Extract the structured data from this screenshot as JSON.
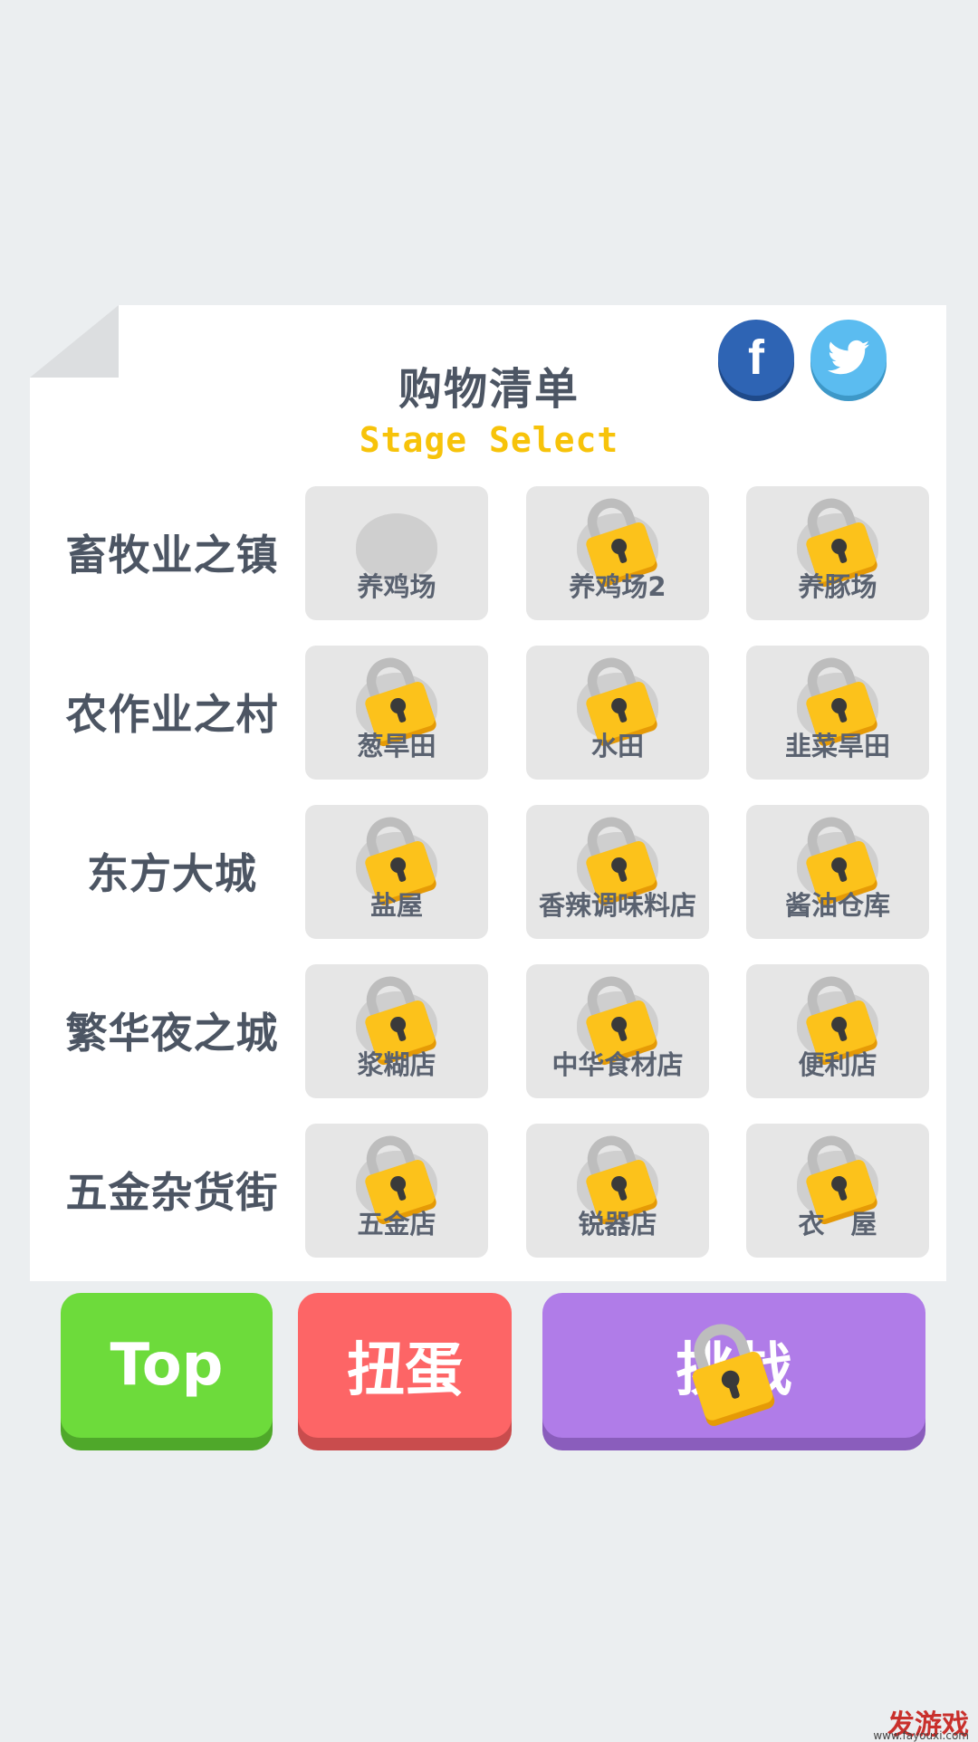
{
  "header": {
    "title": "购物清单",
    "subtitle": "Stage Select"
  },
  "social": {
    "facebook_icon": "facebook-icon",
    "twitter_icon": "twitter-icon"
  },
  "rows": [
    {
      "label": "畜牧业之镇",
      "stages": [
        {
          "name": "养鸡场",
          "locked": false
        },
        {
          "name": "养鸡场2",
          "locked": true
        },
        {
          "name": "养豚场",
          "locked": true
        }
      ]
    },
    {
      "label": "农作业之村",
      "stages": [
        {
          "name": "葱旱田",
          "locked": true
        },
        {
          "name": "水田",
          "locked": true
        },
        {
          "name": "韭菜旱田",
          "locked": true
        }
      ]
    },
    {
      "label": "东方大城",
      "stages": [
        {
          "name": "盐屋",
          "locked": true
        },
        {
          "name": "香辣调味料店",
          "locked": true
        },
        {
          "name": "酱油仓库",
          "locked": true
        }
      ]
    },
    {
      "label": "繁华夜之城",
      "stages": [
        {
          "name": "浆糊店",
          "locked": true
        },
        {
          "name": "中华食材店",
          "locked": true
        },
        {
          "name": "便利店",
          "locked": true
        }
      ]
    },
    {
      "label": "五金杂货街",
      "stages": [
        {
          "name": "五金店",
          "locked": true
        },
        {
          "name": "锐器店",
          "locked": true
        },
        {
          "name": "衣　屋",
          "locked": true
        }
      ]
    }
  ],
  "buttons": {
    "top_label": "Top",
    "gacha_label": "扭蛋",
    "challenge_label": "挑战",
    "challenge_locked": true
  },
  "watermark": {
    "brand": "发游戏",
    "url": "www.fayouxi.com"
  },
  "colors": {
    "accent_yellow": "#f7c30a",
    "top_green": "#6ddb3b",
    "gacha_red": "#fd6566",
    "challenge_purple": "#b07ce8"
  }
}
